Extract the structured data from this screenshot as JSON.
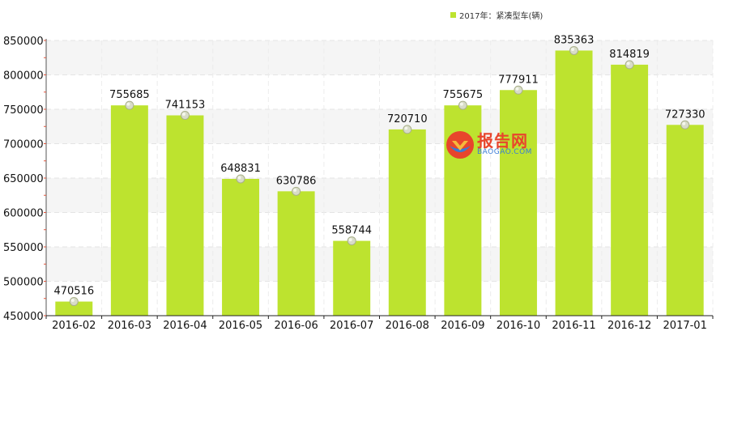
{
  "legend": {
    "label": "2017年：紧凑型车(辆)",
    "color": "#bde32f"
  },
  "watermark": {
    "title": "报告网",
    "subtitle": "BAOGAO.COM"
  },
  "chart_data": {
    "type": "bar",
    "categories": [
      "2016-02",
      "2016-03",
      "2016-04",
      "2016-05",
      "2016-06",
      "2016-07",
      "2016-08",
      "2016-09",
      "2016-10",
      "2016-11",
      "2016-12",
      "2017-01"
    ],
    "series": [
      {
        "name": "2017年：紧凑型车(辆)",
        "values": [
          470516,
          755685,
          741153,
          648831,
          630786,
          558744,
          720710,
          755675,
          777911,
          835363,
          814819,
          727330
        ]
      }
    ],
    "ylim": [
      450000,
      850000
    ],
    "yticks": [
      450000,
      500000,
      550000,
      600000,
      650000,
      700000,
      750000,
      800000,
      850000
    ],
    "bar_color": "#bde32f",
    "grid": true,
    "legend_position": "top-center"
  }
}
